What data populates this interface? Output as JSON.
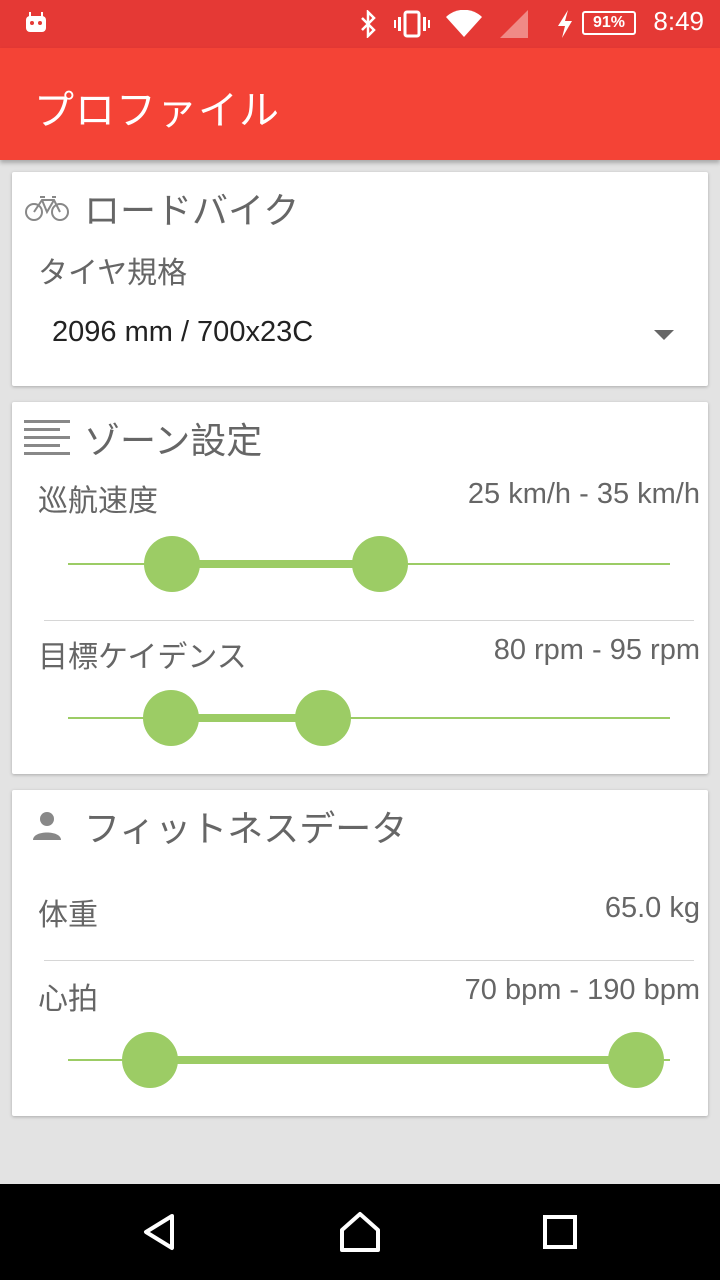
{
  "status_bar": {
    "time": "8:49",
    "battery": "91%",
    "icons": [
      "android-icon",
      "bluetooth-icon",
      "vibrate-icon",
      "wifi-icon",
      "signal-icon",
      "charging-icon"
    ]
  },
  "app_bar": {
    "title": "プロファイル"
  },
  "bike_card": {
    "title": "ロードバイク",
    "icon": "bicycle-icon",
    "tire_label": "タイヤ規格",
    "tire_value": "2096 mm / 700x23C"
  },
  "zone_card": {
    "title": "ゾーン設定",
    "icon": "list-icon",
    "cruise": {
      "label": "巡航速度",
      "value": "25 km/h - 35 km/h",
      "low_fraction": 0.173,
      "high_fraction": 0.518
    },
    "cadence": {
      "label": "目標ケイデンス",
      "value": "80 rpm - 95 rpm",
      "low_fraction": 0.171,
      "high_fraction": 0.423
    }
  },
  "fitness_card": {
    "title": "フィットネスデータ",
    "icon": "person-icon",
    "weight": {
      "label": "体重",
      "value": "65.0 kg"
    },
    "heart": {
      "label": "心拍",
      "value": "70 bpm - 190 bpm",
      "low_fraction": 0.136,
      "high_fraction": 0.943
    }
  },
  "colors": {
    "accent": "#9ccc65",
    "app_bar": "#f44336",
    "status_bar": "#e53935"
  },
  "nav_bar": {
    "buttons": [
      "back-icon",
      "home-icon",
      "recents-icon"
    ]
  }
}
